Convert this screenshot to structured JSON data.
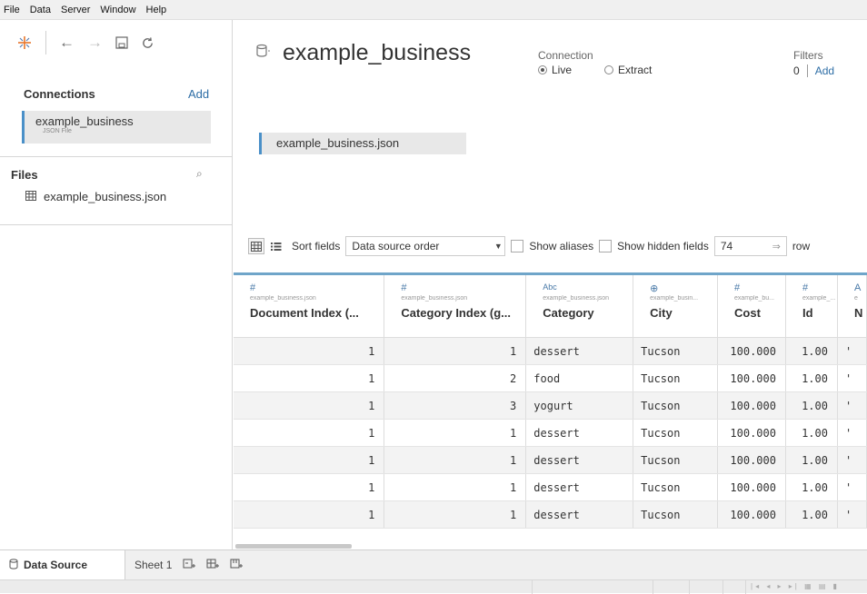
{
  "menu": [
    "File",
    "Data",
    "Server",
    "Window",
    "Help"
  ],
  "toolbar": {
    "icons": [
      "tableau-logo-icon",
      "back-arrow-icon",
      "forward-arrow-icon",
      "save-icon",
      "refresh-icon"
    ]
  },
  "connections": {
    "heading": "Connections",
    "add_label": "Add",
    "item_name": "example_business",
    "item_type": "JSON File"
  },
  "files": {
    "heading": "Files",
    "items": [
      "example_business.json"
    ]
  },
  "datasource": {
    "name": "example_business",
    "connection_label": "Connection",
    "live_label": "Live",
    "extract_label": "Extract",
    "selected_mode": "Live",
    "filters_label": "Filters",
    "filters_count": "0",
    "filters_add": "Add",
    "canvas_table": "example_business.json"
  },
  "grid_toolbar": {
    "sort_label": "Sort fields",
    "sort_value": "Data source order",
    "show_aliases": "Show aliases",
    "show_hidden": "Show hidden fields",
    "rows_value": "74",
    "rows_label": "row"
  },
  "columns": [
    {
      "type_icon": "#",
      "source": "example_business.json",
      "name": "Document Index (...",
      "align": "num"
    },
    {
      "type_icon": "#",
      "source": "example_business.json",
      "name": "Category Index (g...",
      "align": "num"
    },
    {
      "type_icon": "Abc",
      "source": "example_business.json",
      "name": "Category",
      "align": "str"
    },
    {
      "type_icon": "⊕",
      "source": "example_busin...",
      "name": "City",
      "align": "str"
    },
    {
      "type_icon": "#",
      "source": "example_bu...",
      "name": "Cost",
      "align": "num"
    },
    {
      "type_icon": "#",
      "source": "example_...",
      "name": "Id",
      "align": "num"
    },
    {
      "type_icon": "A",
      "source": "e",
      "name": "N",
      "align": "str"
    }
  ],
  "rows": [
    [
      "1",
      "1",
      "dessert",
      "Tucson",
      "100.000",
      "1.00",
      "'"
    ],
    [
      "1",
      "2",
      "food",
      "Tucson",
      "100.000",
      "1.00",
      "'"
    ],
    [
      "1",
      "3",
      "yogurt",
      "Tucson",
      "100.000",
      "1.00",
      "'"
    ],
    [
      "1",
      "1",
      "dessert",
      "Tucson",
      "100.000",
      "1.00",
      "'"
    ],
    [
      "1",
      "1",
      "dessert",
      "Tucson",
      "100.000",
      "1.00",
      "'"
    ],
    [
      "1",
      "1",
      "dessert",
      "Tucson",
      "100.000",
      "1.00",
      "'"
    ],
    [
      "1",
      "1",
      "dessert",
      "Tucson",
      "100.000",
      "1.00",
      "'"
    ]
  ],
  "tabs": {
    "data_source": "Data Source",
    "sheet": "Sheet 1",
    "new_icons": [
      "new-worksheet-icon",
      "new-dashboard-icon",
      "new-story-icon"
    ]
  },
  "statusbar": {
    "nav_glyphs": "|◂ ◂ ▸ ▸|  ▦ ▤ ▮"
  },
  "colors": {
    "accent": "#4a90c8",
    "link": "#2e6ea6",
    "header_rule": "#6fa5c9"
  }
}
